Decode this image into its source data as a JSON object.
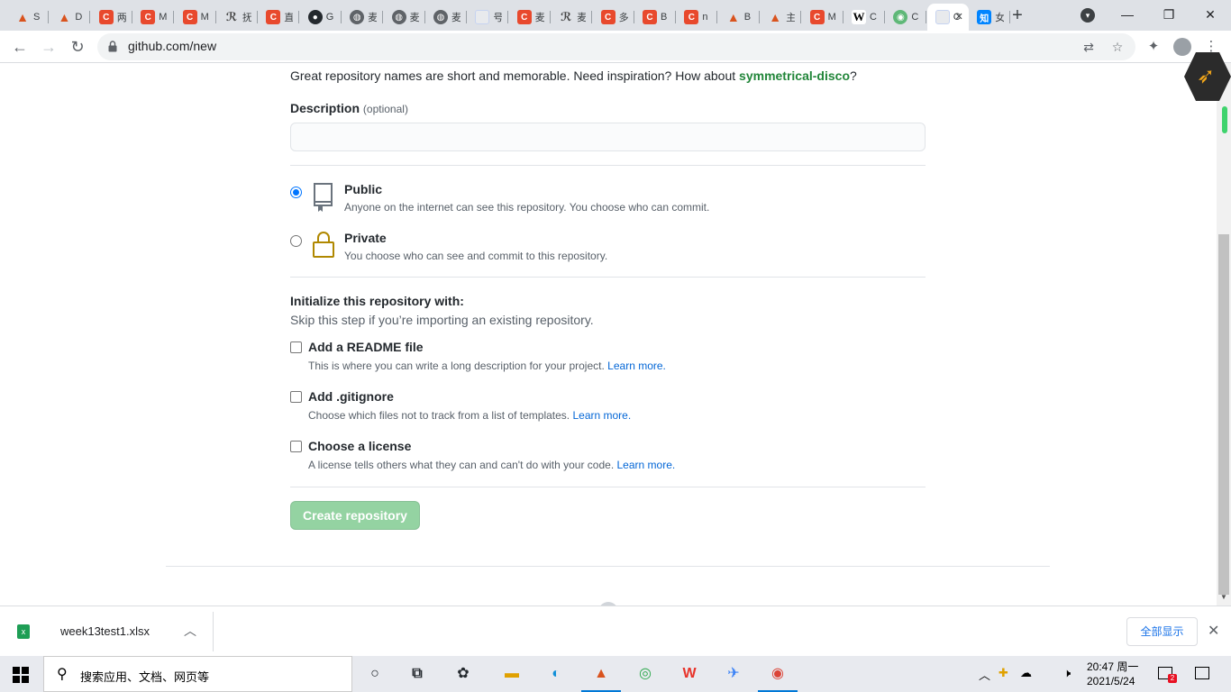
{
  "browser": {
    "tabs": [
      {
        "icon": "matlab-icon",
        "glyph": "▲",
        "label": "S",
        "cls": "matlab"
      },
      {
        "icon": "matlab-icon",
        "glyph": "▲",
        "label": "D",
        "cls": "matlab"
      },
      {
        "icon": "csdn-icon",
        "glyph": "C",
        "label": "两",
        "cls": "csdn"
      },
      {
        "icon": "csdn-icon",
        "glyph": "C",
        "label": "M",
        "cls": "csdn"
      },
      {
        "icon": "csdn-icon",
        "glyph": "C",
        "label": "M",
        "cls": "csdn"
      },
      {
        "icon": "script-icon",
        "glyph": "ℛ",
        "label": "抚",
        "cls": "script"
      },
      {
        "icon": "csdn-icon",
        "glyph": "C",
        "label": "直",
        "cls": "csdn"
      },
      {
        "icon": "github-icon",
        "glyph": "●",
        "label": "G",
        "cls": "github"
      },
      {
        "icon": "globe-icon",
        "glyph": "◍",
        "label": "麦",
        "cls": "globe"
      },
      {
        "icon": "globe-icon",
        "glyph": "◍",
        "label": "麦",
        "cls": "globe"
      },
      {
        "icon": "globe-icon",
        "glyph": "◍",
        "label": "麦",
        "cls": "globe"
      },
      {
        "icon": "blank-page-icon",
        "glyph": "",
        "label": "号",
        "cls": "blank"
      },
      {
        "icon": "csdn-icon",
        "glyph": "C",
        "label": "麦",
        "cls": "csdn"
      },
      {
        "icon": "script-icon",
        "glyph": "ℛ",
        "label": "麦",
        "cls": "script"
      },
      {
        "icon": "csdn-icon",
        "glyph": "C",
        "label": "多",
        "cls": "csdn"
      },
      {
        "icon": "csdn-icon",
        "glyph": "C",
        "label": "B",
        "cls": "csdn"
      },
      {
        "icon": "csdn-icon",
        "glyph": "C",
        "label": "n",
        "cls": "csdn"
      },
      {
        "icon": "matlab-icon",
        "glyph": "▲",
        "label": "B",
        "cls": "matlab"
      },
      {
        "icon": "matlab-icon",
        "glyph": "▲",
        "label": "主",
        "cls": "matlab"
      },
      {
        "icon": "csdn-icon",
        "glyph": "C",
        "label": "M",
        "cls": "csdn"
      },
      {
        "icon": "wikipedia-icon",
        "glyph": "W",
        "label": "C",
        "cls": "wiki"
      },
      {
        "icon": "green-circle-icon",
        "glyph": "◉",
        "label": "C",
        "cls": "green"
      },
      {
        "icon": "github-icon",
        "glyph": "",
        "label": "C",
        "cls": "blank",
        "active": true
      },
      {
        "icon": "zhihu-icon",
        "glyph": "知",
        "label": "女",
        "cls": "zhihu"
      }
    ],
    "new_tab": "+",
    "url": "github.com/new"
  },
  "form": {
    "hint_prefix": "Great repository names are short and memorable. Need inspiration? How about ",
    "hint_suggestion": "symmetrical-disco",
    "hint_suffix": "?",
    "description_label": "Description",
    "description_optional": "(optional)",
    "description_value": "",
    "visibility": [
      {
        "title": "Public",
        "desc": "Anyone on the internet can see this repository. You choose who can commit.",
        "checked": true
      },
      {
        "title": "Private",
        "desc": "You choose who can see and commit to this repository.",
        "checked": false
      }
    ],
    "init_title": "Initialize this repository with:",
    "init_subtitle": "Skip this step if you’re importing an existing repository.",
    "init_options": [
      {
        "title": "Add a README file",
        "desc": "This is where you can write a long description for your project.",
        "link": "Learn more."
      },
      {
        "title": "Add .gitignore",
        "desc": "Choose which files not to track from a list of templates.",
        "link": "Learn more."
      },
      {
        "title": "Choose a license",
        "desc": "A license tells others what they can and can't do with your code.",
        "link": "Learn more."
      }
    ],
    "create_button": "Create repository"
  },
  "download_bar": {
    "file_name": "week13test1.xlsx",
    "show_all": "全部显示"
  },
  "taskbar": {
    "search_placeholder": "搜索应用、文档、网页等",
    "time": "20:47 周一",
    "date": "2021/5/24",
    "notification_count": "2"
  },
  "colors": {
    "accent_green": "#22863a",
    "create_button_disabled": "#94d3a2",
    "link_blue": "#0366d6",
    "private_lock": "#b08800"
  }
}
